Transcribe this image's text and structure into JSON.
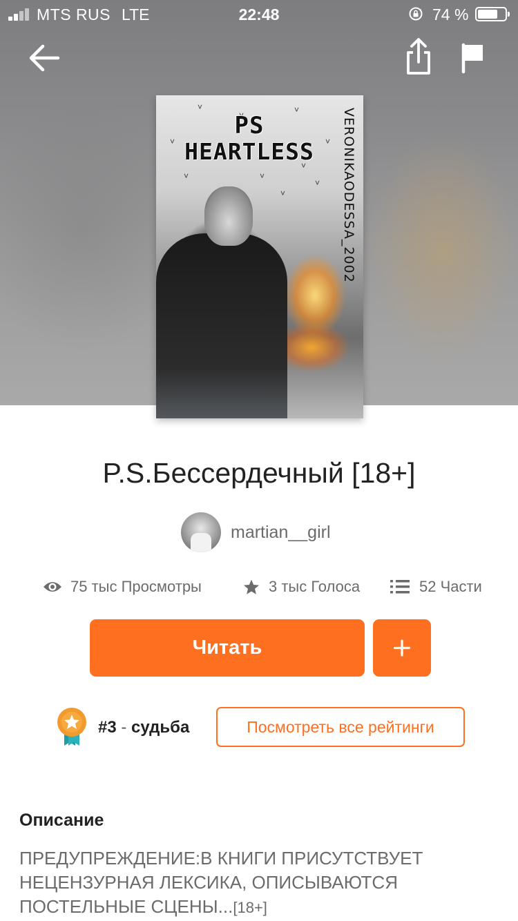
{
  "status_bar": {
    "carrier": "MTS RUS",
    "network": "LTE",
    "time": "22:48",
    "battery_percent": "74 %",
    "battery_level": 0.74
  },
  "header": {
    "back_icon": "arrow-left-icon",
    "share_icon": "share-icon",
    "report_icon": "flag-icon"
  },
  "cover": {
    "title_line1": "PS",
    "title_line2": "HEARTLESS",
    "author_credit": "VERONIKAODESSA_2002"
  },
  "book": {
    "title": "P.S.Бессердечный [18+]",
    "author": "martian__girl"
  },
  "stats": {
    "views": "75 тыс Просмотры",
    "votes": "3 тыс Голоса",
    "parts": "52 Части"
  },
  "actions": {
    "read_label": "Читать",
    "add_label": "+",
    "accent_color": "#ff6f20"
  },
  "ranking": {
    "rank": "#3",
    "separator": "-",
    "tag": "судьба",
    "all_ratings_label": "Посмотреть все рейтинги"
  },
  "description": {
    "heading": "Описание",
    "text": "ПРЕДУПРЕЖДЕНИЕ:В КНИГИ ПРИСУТСТВУЕТ НЕЦЕНЗУРНАЯ ЛЕКСИКА, ОПИСЫВАЮТСЯ ПОСТЕЛЬНЫЕ СЦЕНЫ...",
    "more": "[18+]"
  }
}
